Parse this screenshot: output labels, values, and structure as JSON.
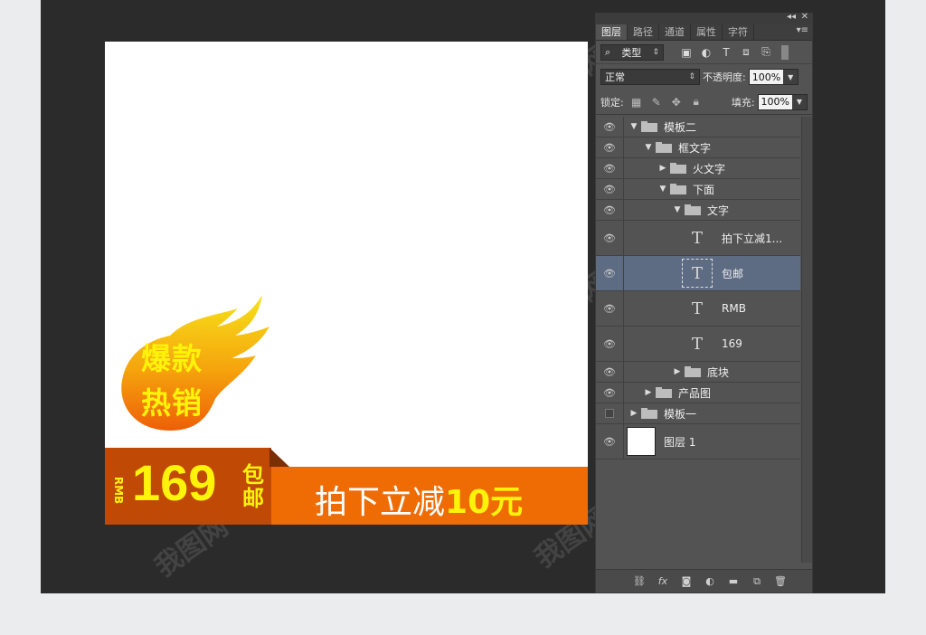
{
  "canvas": {
    "badge_line1": "爆款",
    "badge_line2": "热销",
    "currency": "RMB",
    "price": "169",
    "free_shipping": "包邮",
    "promo_text": "拍下立减",
    "promo_amount": "10元"
  },
  "panel": {
    "tabs": [
      "图层",
      "路径",
      "通道",
      "属性",
      "字符"
    ],
    "filter": {
      "kind_label": "类型"
    },
    "blend_mode": "正常",
    "opacity_label": "不透明度:",
    "opacity_value": "100%",
    "lock_label": "锁定:",
    "fill_label": "填充:",
    "fill_value": "100%",
    "layers": [
      {
        "name": "模板二",
        "type": "group",
        "expanded": true
      },
      {
        "name": "框文字",
        "type": "group",
        "expanded": true
      },
      {
        "name": "火文字",
        "type": "group",
        "expanded": false
      },
      {
        "name": "下面",
        "type": "group",
        "expanded": true
      },
      {
        "name": "文字",
        "type": "group",
        "expanded": true
      },
      {
        "name": "拍下立减1...",
        "type": "text"
      },
      {
        "name": "包邮",
        "type": "text",
        "selected": true
      },
      {
        "name": "RMB",
        "type": "text"
      },
      {
        "name": "169",
        "type": "text"
      },
      {
        "name": "底块",
        "type": "group",
        "expanded": false
      },
      {
        "name": "产品图",
        "type": "group",
        "expanded": false
      },
      {
        "name": "模板一",
        "type": "group",
        "expanded": false,
        "visible": false
      },
      {
        "name": "图层 1",
        "type": "pixel"
      }
    ]
  },
  "colors": {
    "workspace_bg": "#2b2b2b",
    "banner_orange": "#ef6c05",
    "banner_dark": "#c04a05",
    "price_yellow": "#fff30a",
    "selected_layer": "#5d6b83"
  }
}
